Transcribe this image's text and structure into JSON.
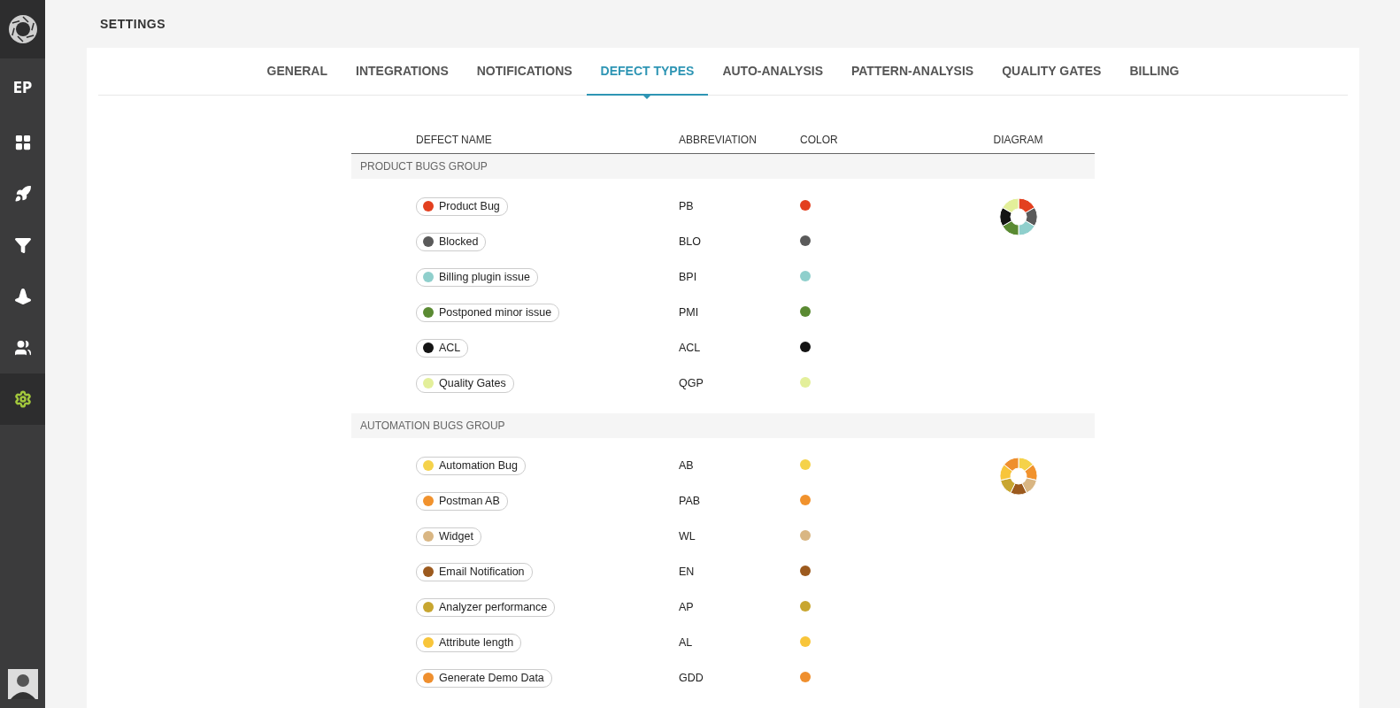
{
  "sidebar": {
    "project": "EP",
    "items": [
      {
        "selected": false
      },
      {
        "selected": false
      },
      {
        "selected": false
      },
      {
        "selected": false
      },
      {
        "selected": false
      },
      {
        "selected": true
      }
    ]
  },
  "page_title": "SETTINGS",
  "tabs": [
    {
      "label": "GENERAL",
      "selected": false
    },
    {
      "label": "INTEGRATIONS",
      "selected": false
    },
    {
      "label": "NOTIFICATIONS",
      "selected": false
    },
    {
      "label": "DEFECT TYPES",
      "selected": true
    },
    {
      "label": "AUTO-ANALYSIS",
      "selected": false
    },
    {
      "label": "PATTERN-ANALYSIS",
      "selected": false
    },
    {
      "label": "QUALITY GATES",
      "selected": false
    },
    {
      "label": "BILLING",
      "selected": false
    }
  ],
  "table": {
    "columns": [
      "DEFECT NAME",
      "ABBREVIATION",
      "COLOR",
      "DIAGRAM"
    ],
    "groups": [
      {
        "name": "PRODUCT BUGS GROUP",
        "rows": [
          {
            "name": "Product Bug",
            "abbreviation": "PB",
            "color": "#e3401f"
          },
          {
            "name": "Blocked",
            "abbreviation": "BLO",
            "color": "#5a5a5a"
          },
          {
            "name": "Billing plugin issue",
            "abbreviation": "BPI",
            "color": "#8fcfcc"
          },
          {
            "name": "Postponed minor issue",
            "abbreviation": "PMI",
            "color": "#5a8a32"
          },
          {
            "name": "ACL",
            "abbreviation": "ACL",
            "color": "#141414"
          },
          {
            "name": "Quality Gates",
            "abbreviation": "QGP",
            "color": "#e3ef9a"
          }
        ]
      },
      {
        "name": "AUTOMATION BUGS GROUP",
        "rows": [
          {
            "name": "Automation Bug",
            "abbreviation": "AB",
            "color": "#f5d24a"
          },
          {
            "name": "Postman AB",
            "abbreviation": "PAB",
            "color": "#f1922d"
          },
          {
            "name": "Widget",
            "abbreviation": "WL",
            "color": "#d9b683"
          },
          {
            "name": "Email Notification",
            "abbreviation": "EN",
            "color": "#9c5a1e"
          },
          {
            "name": "Analyzer performance",
            "abbreviation": "AP",
            "color": "#c8a630"
          },
          {
            "name": "Attribute length",
            "abbreviation": "AL",
            "color": "#f8c53a"
          },
          {
            "name": "Generate Demo Data",
            "abbreviation": "GDD",
            "color": "#ef8f2e"
          }
        ]
      }
    ]
  }
}
